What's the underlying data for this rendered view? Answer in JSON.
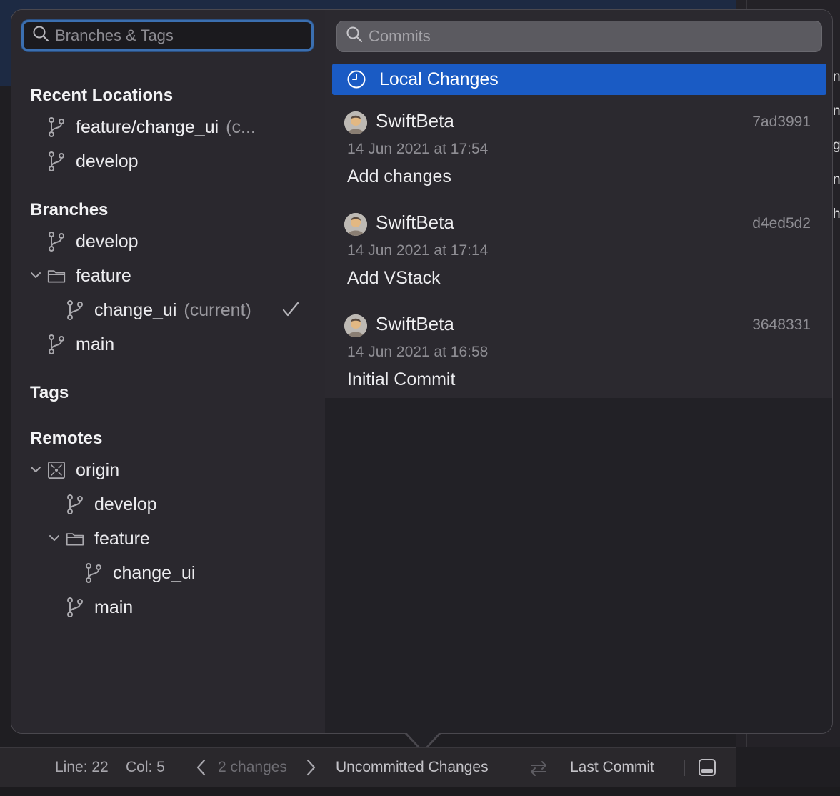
{
  "branches_panel": {
    "search_placeholder": "Branches & Tags",
    "recent_locations": {
      "title": "Recent Locations",
      "items": [
        {
          "label": "feature/change_ui",
          "suffix": "(c..."
        },
        {
          "label": "develop"
        }
      ]
    },
    "branches": {
      "title": "Branches",
      "develop": "develop",
      "feature_folder": "feature",
      "change_ui": "change_ui",
      "change_ui_suffix": "(current)",
      "main": "main"
    },
    "tags": {
      "title": "Tags"
    },
    "remotes": {
      "title": "Remotes",
      "origin": "origin",
      "develop": "develop",
      "feature_folder": "feature",
      "change_ui": "change_ui",
      "main": "main"
    }
  },
  "commits_panel": {
    "search_placeholder": "Commits",
    "local_changes_label": "Local Changes",
    "commits": [
      {
        "author": "SwiftBeta",
        "hash": "7ad3991",
        "date": "14 Jun 2021 at 17:54",
        "message": "Add changes"
      },
      {
        "author": "SwiftBeta",
        "hash": "d4ed5d2",
        "date": "14 Jun 2021 at 17:14",
        "message": "Add VStack"
      },
      {
        "author": "SwiftBeta",
        "hash": "3648331",
        "date": "14 Jun 2021 at 16:58",
        "message": "Initial Commit"
      }
    ]
  },
  "statusbar": {
    "line": "Line: 22",
    "col": "Col: 5",
    "changes": "2 changes",
    "uncommitted": "Uncommitted Changes",
    "last_commit": "Last Commit"
  },
  "background": {
    "right_edge_letters": [
      "n",
      "n",
      "g",
      "n",
      "h"
    ]
  },
  "colors": {
    "accent_selection": "#1a5bc4",
    "search_focus_ring": "#3b6fb0",
    "popover_bg": "#2a282e"
  },
  "icons": {
    "search": "search-icon",
    "branch": "branch-icon",
    "folder": "folder-icon",
    "remote": "remote-icon",
    "clock": "clock-icon",
    "avatar": "person-avatar-icon",
    "check": "checkmark-icon",
    "chevron": "chevron-down-icon",
    "nav_prev": "chevron-left-icon",
    "nav_next": "chevron-right-icon",
    "compare": "compare-arrows-icon",
    "panel": "panel-toggle-icon"
  }
}
